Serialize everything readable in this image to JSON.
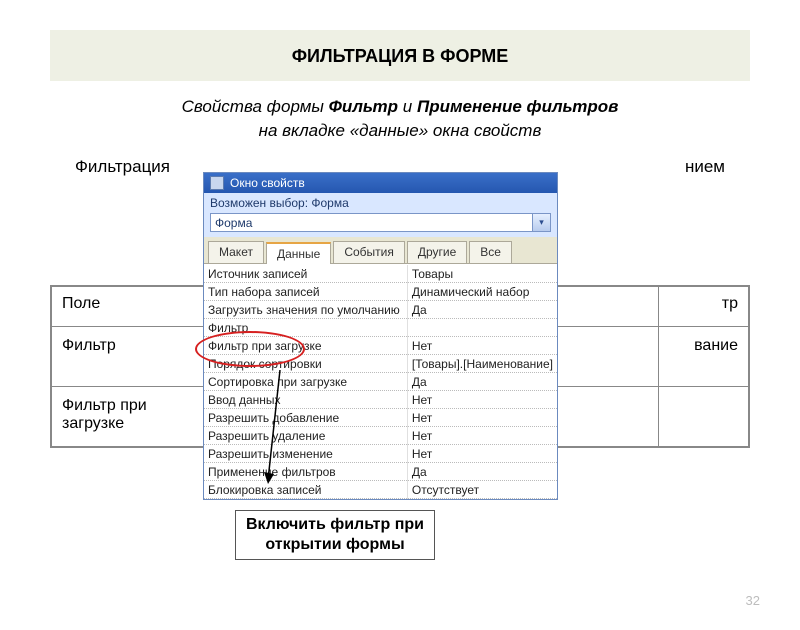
{
  "slide": {
    "title": "ФИЛЬТРАЦИЯ В ФОРМЕ",
    "desc_prefix": "Свойства формы ",
    "desc_b1": "Фильтр",
    "desc_mid": " и ",
    "desc_b2": "Применение фильтров",
    "desc_line2": "на вкладке «данные» окна свойств",
    "filt_left": "Фильтрация",
    "filt_right": "нием",
    "page": "32"
  },
  "bgtable": {
    "h1": "Поле",
    "h2": "тр",
    "r1c1": "Фильтр",
    "r1c2": "вание",
    "r2c1": "Фильтр при загрузке",
    "r2c2": ""
  },
  "win": {
    "title": "Окно свойств",
    "selector_label": "Возможен выбор:  Форма",
    "combo_value": "Форма",
    "tabs": [
      "Макет",
      "Данные",
      "События",
      "Другие",
      "Все"
    ],
    "active_tab": 1,
    "rows": [
      {
        "k": "Источник записей",
        "v": "Товары"
      },
      {
        "k": "Тип набора записей",
        "v": "Динамический набор"
      },
      {
        "k": "Загрузить значения по умолчанию",
        "v": "Да"
      },
      {
        "k": "Фильтр",
        "v": ""
      },
      {
        "k": "Фильтр при загрузке",
        "v": "Нет"
      },
      {
        "k": "Порядок сортировки",
        "v": "[Товары].[Наименование]"
      },
      {
        "k": "Сортировка при загрузке",
        "v": "Да"
      },
      {
        "k": "Ввод данных",
        "v": "Нет"
      },
      {
        "k": "Разрешить добавление",
        "v": "Нет"
      },
      {
        "k": "Разрешить удаление",
        "v": "Нет"
      },
      {
        "k": "Разрешить изменение",
        "v": "Нет"
      },
      {
        "k": "Применение фильтров",
        "v": "Да"
      },
      {
        "k": "Блокировка записей",
        "v": "Отсутствует"
      }
    ]
  },
  "callout": {
    "text": "Включить фильтр при открытии формы"
  }
}
